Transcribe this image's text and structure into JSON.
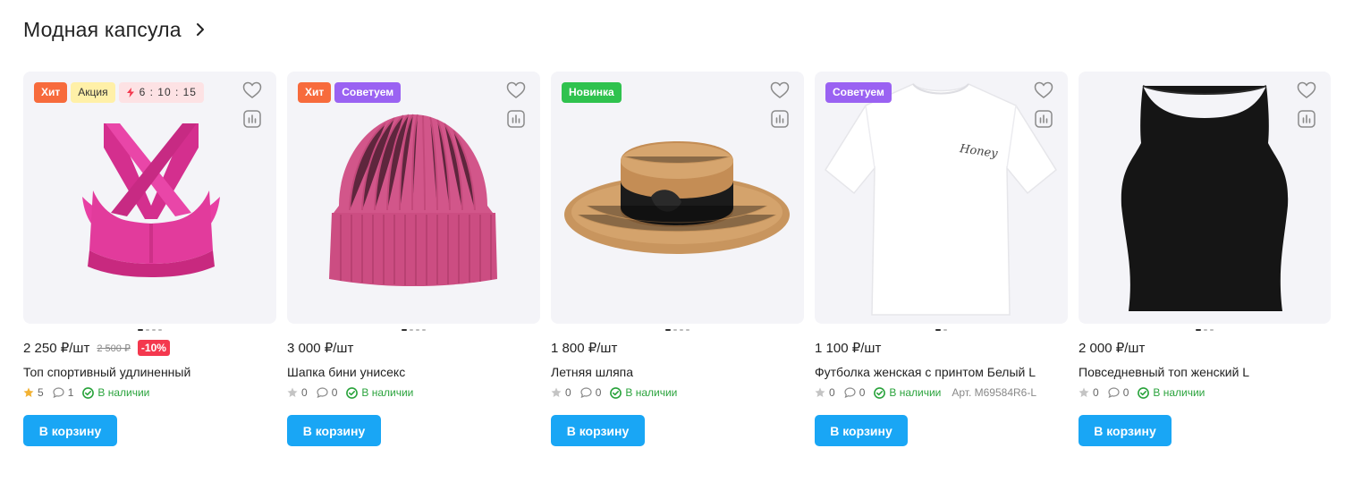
{
  "section": {
    "title": "Модная капсула"
  },
  "products": [
    {
      "badges": [
        "Хит",
        "Акция"
      ],
      "timer": "6 : 10 : 15",
      "price": "2 250 ₽/шт",
      "old_price": "2 500 ₽",
      "discount": "-10%",
      "name": "Топ спортивный удлиненный",
      "rating": "5",
      "reviews": "1",
      "stock": "В наличии",
      "sku": "",
      "buy_label": "В корзину",
      "image": "pink sports bra",
      "image_color": "#e83fa3"
    },
    {
      "badges": [
        "Хит",
        "Советуем"
      ],
      "price": "3 000 ₽/шт",
      "name": "Шапка бини унисекс",
      "rating": "0",
      "reviews": "0",
      "stock": "В наличии",
      "buy_label": "В корзину",
      "image": "pink knit beanie",
      "image_color": "#d2568a"
    },
    {
      "badges": [
        "Новинка"
      ],
      "price": "1 800 ₽/шт",
      "name": "Летняя шляпа",
      "rating": "0",
      "reviews": "0",
      "stock": "В наличии",
      "buy_label": "В корзину",
      "image": "straw boater hat",
      "image_color": "#c8955e"
    },
    {
      "badges": [
        "Советуем"
      ],
      "price": "1 100 ₽/шт",
      "name": "Футболка женская с принтом Белый L",
      "rating": "0",
      "reviews": "0",
      "stock": "В наличии",
      "sku": "Арт. M69584R6-L",
      "buy_label": "В корзину",
      "image": "white t-shirt",
      "image_text": "Honey",
      "image_color": "#ffffff"
    },
    {
      "badges": [],
      "price": "2 000 ₽/шт",
      "name": "Повседневный топ женский L",
      "rating": "0",
      "reviews": "0",
      "stock": "В наличии",
      "buy_label": "В корзину",
      "image": "black tank top",
      "image_color": "#151515"
    }
  ],
  "colors": {
    "accent": "#19a6f5",
    "hit": "#f76b3c",
    "promo": "#fff0a8",
    "timer": "#fde2e4",
    "advice": "#9a62f2",
    "new": "#2fc24e",
    "discount": "#f4384e",
    "stock": "#2aa33c",
    "star_active": "#f2b233",
    "star_inactive": "#c4c4c4"
  },
  "icons": {
    "header": "chevron-right-icon",
    "favorite": "heart-icon",
    "compare": "bar-chart-icon",
    "timer": "lightning-icon",
    "rating": "star-icon",
    "reviews": "speech-bubble-icon",
    "stock": "check-circle-icon"
  }
}
